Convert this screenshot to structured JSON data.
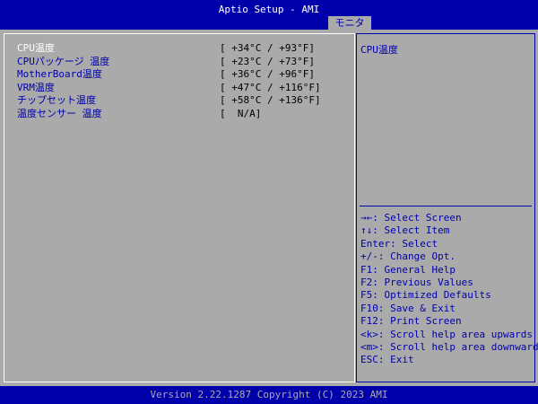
{
  "header": {
    "title": "Aptio Setup - AMI",
    "active_tab": "モニタ"
  },
  "monitor": {
    "items": [
      {
        "label": "CPU温度",
        "value": "[ +34°C / +93°F]"
      },
      {
        "label": "CPUパッケージ 温度",
        "value": "[ +23°C / +73°F]"
      },
      {
        "label": "MotherBoard温度",
        "value": "[ +36°C / +96°F]"
      },
      {
        "label": "VRM温度",
        "value": "[ +47°C / +116°F]"
      },
      {
        "label": "チップセット温度",
        "value": "[ +58°C / +136°F]"
      },
      {
        "label": "温度センサー 温度",
        "value": "[  N/A]"
      }
    ]
  },
  "help": {
    "title": "CPU温度",
    "keys": [
      "→←: Select Screen",
      "↑↓: Select Item",
      "Enter: Select",
      "+/-: Change Opt.",
      "F1: General Help",
      "F2: Previous Values",
      "F5: Optimized Defaults",
      "F10: Save & Exit",
      "F12: Print Screen",
      "<k>: Scroll help area upwards",
      "<m>: Scroll help area downwards",
      "ESC: Exit"
    ]
  },
  "footer": {
    "version": "Version 2.22.1287 Copyright (C) 2023 AMI"
  },
  "colors": {
    "bios_blue": "#0000aa",
    "bios_gray": "#aaaaaa",
    "highlight": "#ffffff"
  }
}
